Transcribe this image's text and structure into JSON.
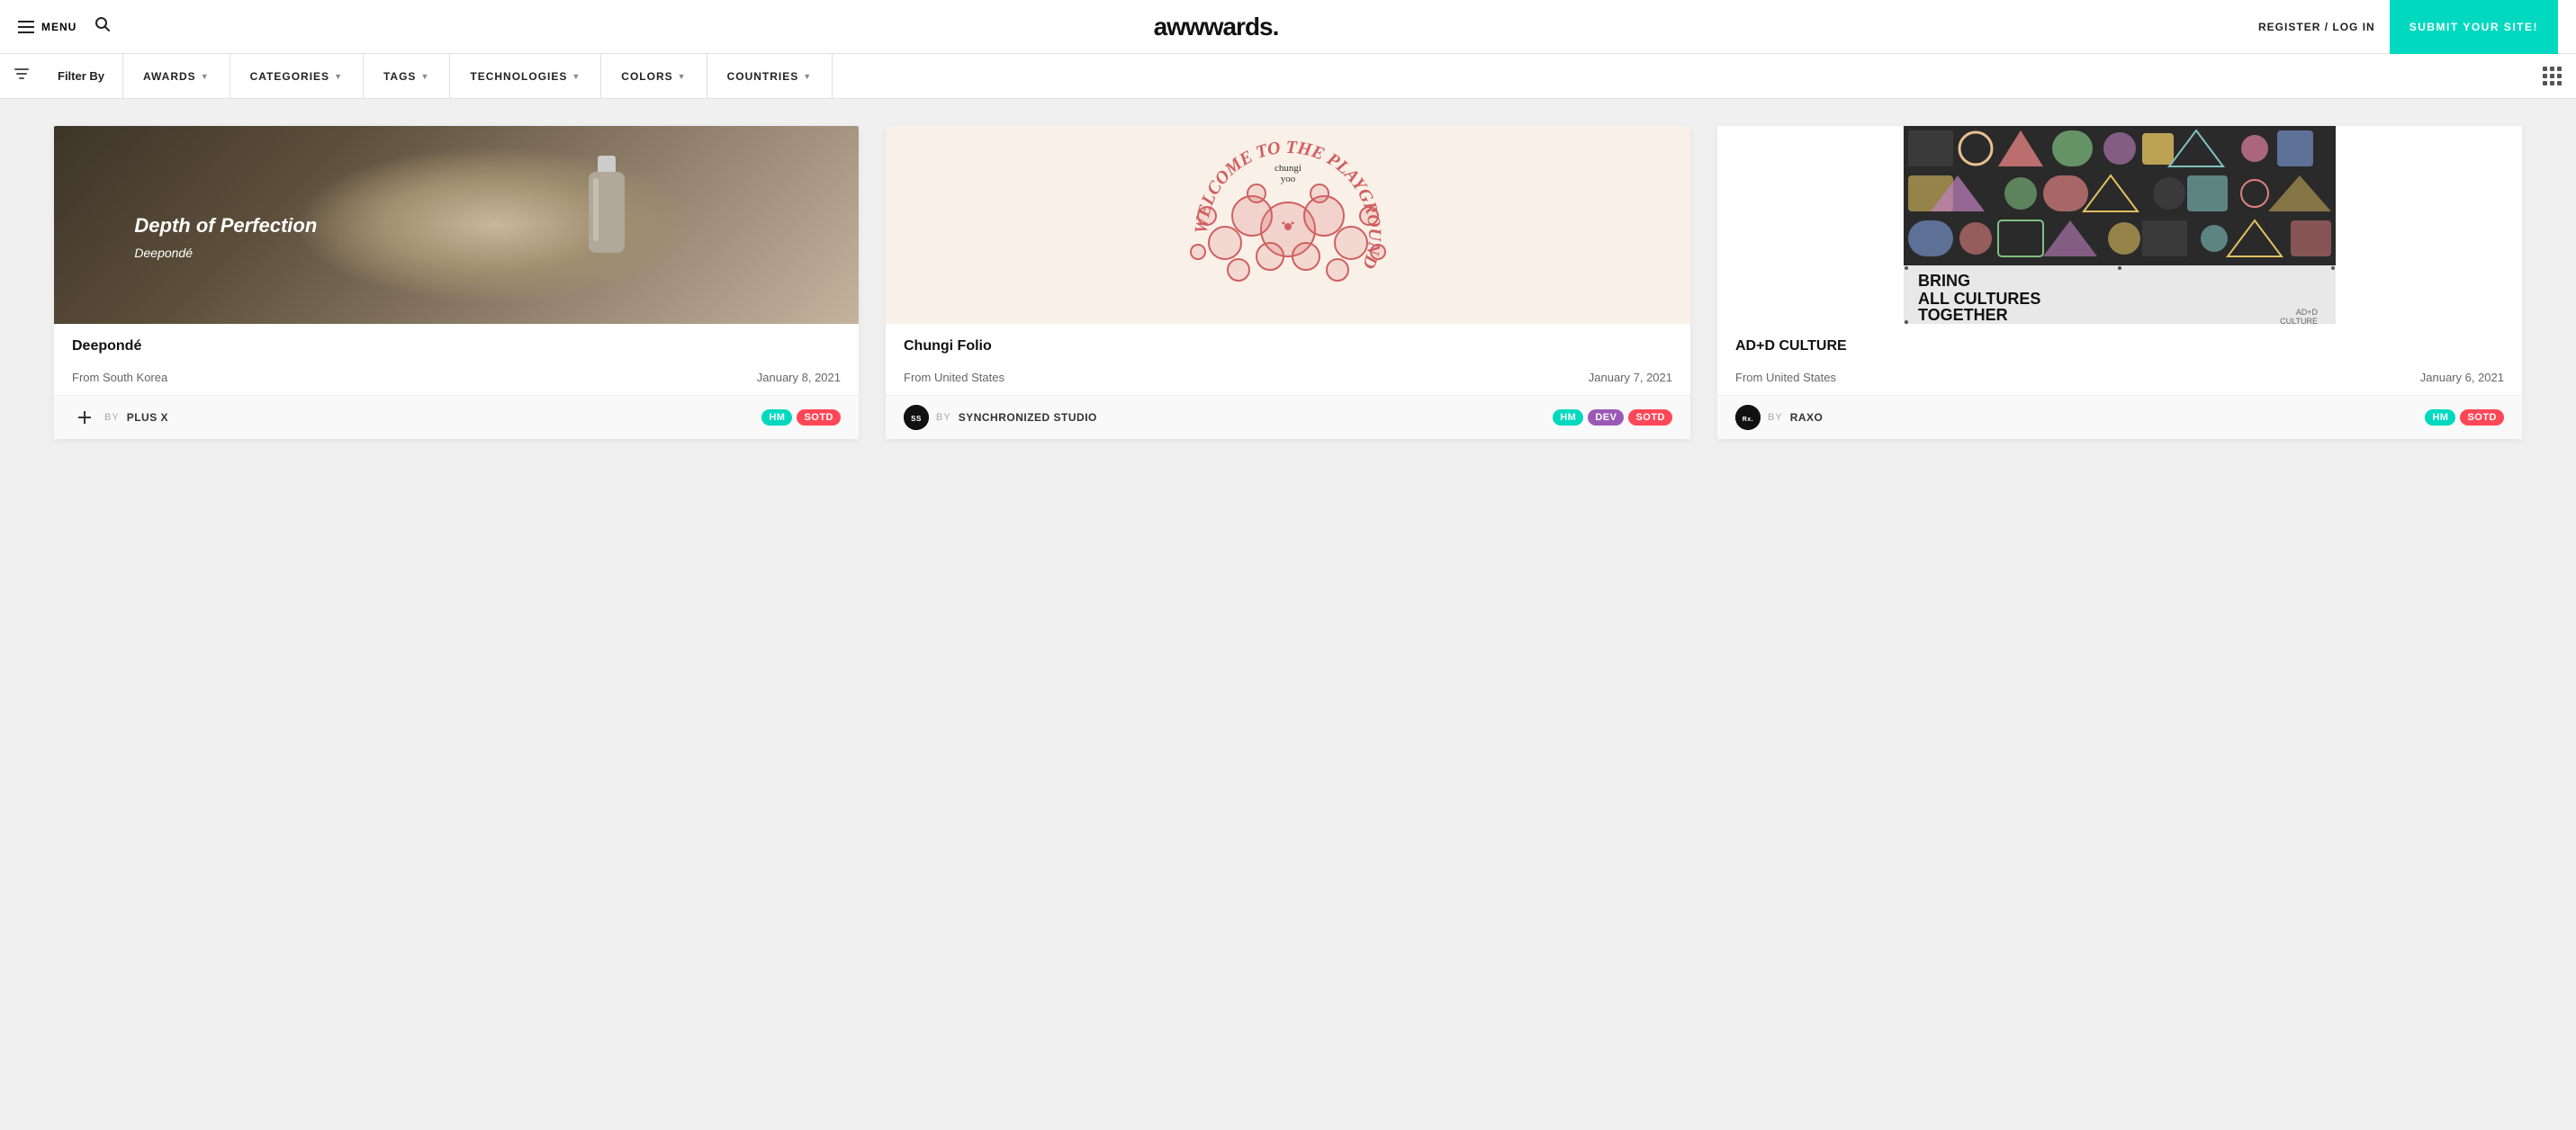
{
  "header": {
    "menu_label": "MENU",
    "logo": "awwwards.",
    "register_label": "REGISTER / LOG IN",
    "submit_label": "SUBMIT YOUR SITE!"
  },
  "filter_bar": {
    "filter_by": "Filter By",
    "items": [
      {
        "id": "awards",
        "label": "AWARDS",
        "has_caret": true
      },
      {
        "id": "categories",
        "label": "CATEGORIES",
        "has_caret": true
      },
      {
        "id": "tags",
        "label": "TAGS",
        "has_caret": true
      },
      {
        "id": "technologies",
        "label": "TECHNOLOGIES",
        "has_caret": true
      },
      {
        "id": "colors",
        "label": "COLORS",
        "has_caret": true
      },
      {
        "id": "countries",
        "label": "COUNTRIES",
        "has_caret": true
      }
    ]
  },
  "cards": [
    {
      "id": "deepponde",
      "title": "Deepondé",
      "from": "From South Korea",
      "date": "January 8, 2021",
      "author_label": "BY",
      "author_name": "PLUS X",
      "author_avatar_bg": "#333",
      "author_initials": "+×",
      "badges": [
        "HM",
        "SOTD"
      ],
      "badge_colors": [
        "#00d9c0",
        "#ff4757"
      ]
    },
    {
      "id": "chungi",
      "title": "Chungi Folio",
      "from": "From United States",
      "date": "January 7, 2021",
      "author_label": "BY",
      "author_name": "SYNCHRONIZED STUDIO",
      "author_avatar_bg": "#111",
      "author_initials": "SS",
      "badges": [
        "HM",
        "DEV",
        "SOTD"
      ],
      "badge_colors": [
        "#00d9c0",
        "#9b59b6",
        "#ff4757"
      ]
    },
    {
      "id": "add-culture",
      "title": "AD+D CULTURE",
      "from": "From United States",
      "date": "January 6, 2021",
      "author_label": "BY",
      "author_name": "RAXO",
      "author_avatar_bg": "#111",
      "author_initials": "Rx.",
      "badges": [
        "HM",
        "SOTD"
      ],
      "badge_colors": [
        "#00d9c0",
        "#ff4757"
      ]
    }
  ]
}
